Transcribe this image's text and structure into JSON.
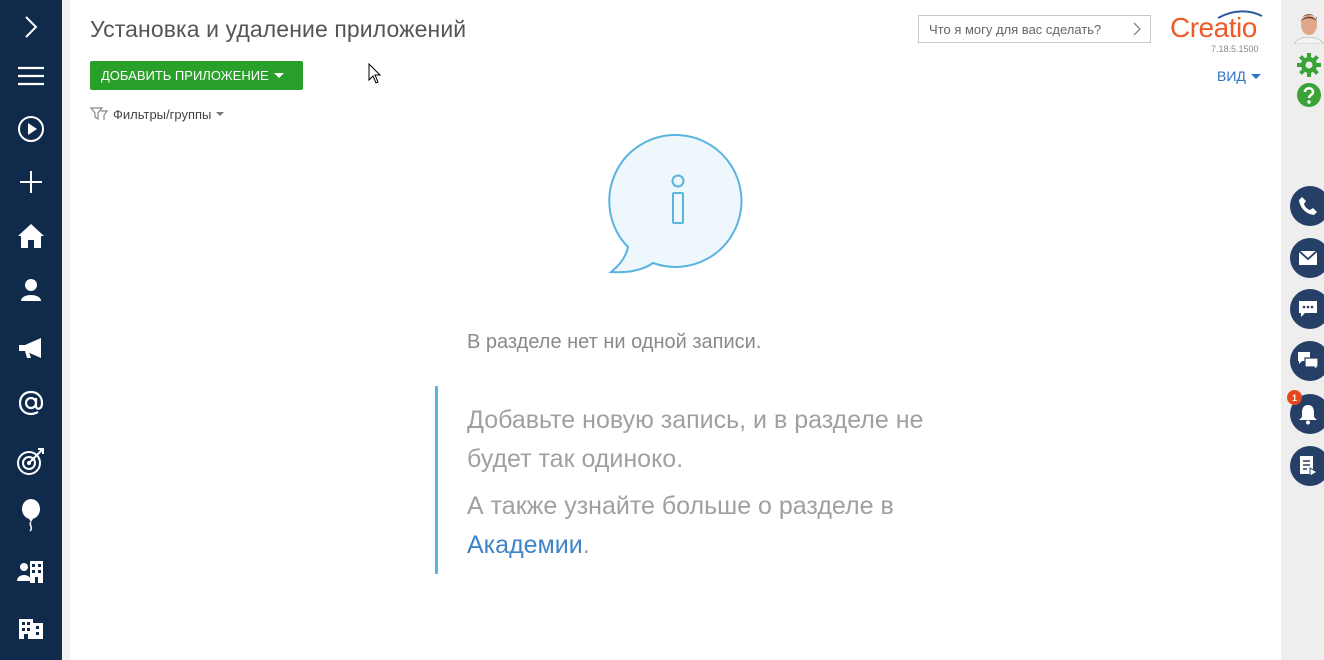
{
  "header": {
    "title": "Установка и удаление приложений",
    "add_button": "ДОБАВИТЬ ПРИЛОЖЕНИЕ",
    "search_placeholder": "Что я могу для вас сделать?",
    "logo": "Creatio",
    "version": "7.18.5.1500",
    "view_button": "ВИД"
  },
  "filters": {
    "label": "Фильтры/группы"
  },
  "empty_state": {
    "message": "В разделе нет ни одной записи.",
    "tip_line1": "Добавьте новую запись, и в разделе не будет так одиноко.",
    "tip_line2_prefix": "А также узнайте больше о разделе в ",
    "tip_link": "Академии",
    "tip_line2_suffix": "."
  },
  "left_nav": {
    "items": [
      "expand-icon",
      "menu-icon",
      "play-icon",
      "plus-icon",
      "home-icon",
      "contact-icon",
      "megaphone-icon",
      "email-at-icon",
      "target-icon",
      "balloon-icon",
      "account-building-icon",
      "building-icon"
    ]
  },
  "right_bar": {
    "items": [
      "avatar",
      "gear-icon",
      "help-icon",
      "phone-icon",
      "envelope-icon",
      "chat-icon",
      "feed-icon",
      "bell-icon",
      "process-icon"
    ],
    "notification_count": "1"
  },
  "colors": {
    "nav_bg": "#0f2a4a",
    "add_button": "#29a029",
    "logo": "#f05a28",
    "accent_blue": "#2e72c4",
    "comm_button": "#253f66",
    "badge": "#e8471b"
  }
}
